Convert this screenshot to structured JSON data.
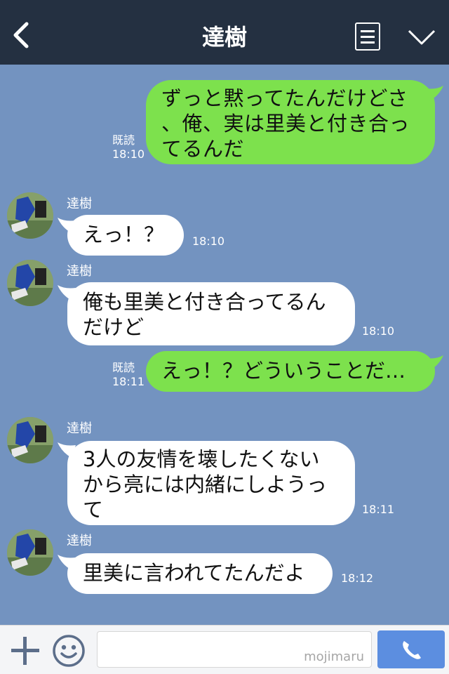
{
  "header": {
    "title": "達樹"
  },
  "messages": [
    {
      "side": "me",
      "text": "ずっと黙ってたんだけどさ\n、俺、実は里美と付き合っ\nてるんだ",
      "read": "既読",
      "time": "18:10"
    },
    {
      "side": "them",
      "name": "達樹",
      "text": "えっ！？",
      "time": "18:10"
    },
    {
      "side": "them",
      "name": "達樹",
      "text": "俺も里美と付き合ってるん\nだけど",
      "time": "18:10"
    },
    {
      "side": "me",
      "text": "えっ！？どういうことだ…",
      "read": "既読",
      "time": "18:11"
    },
    {
      "side": "them",
      "name": "達樹",
      "text": "3人の友情を壊したくない\nから亮には内緒にしようっ\nて",
      "time": "18:11"
    },
    {
      "side": "them",
      "name": "達樹",
      "text": "里美に言われてたんだよ",
      "time": "18:12"
    }
  ],
  "footer": {
    "watermark": "mojimaru"
  },
  "icons": {
    "back": "chevron-left-icon",
    "menu": "menu-icon",
    "collapse": "chevron-down-icon",
    "add": "plus-icon",
    "emoji": "smile-icon",
    "send": "phone-icon"
  },
  "colors": {
    "header": "#243041",
    "background": "#7393c0",
    "my_bubble": "#7de14d",
    "their_bubble": "#ffffff",
    "send_button": "#5c8ee0"
  }
}
